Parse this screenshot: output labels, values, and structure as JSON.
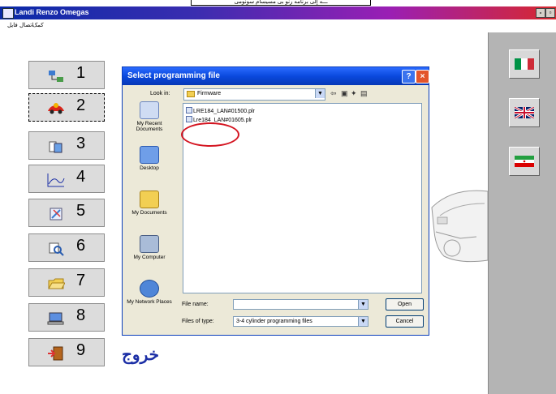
{
  "banner": {
    "text": "ـــه إلى برنامه رنو بی مسیسام سونومی"
  },
  "window": {
    "title": "Landi Renzo Omegas",
    "minimize_label": "-",
    "restore_label": "▫"
  },
  "menu": {
    "items": [
      "فایل",
      "اتصال",
      "کمک"
    ]
  },
  "languages": [
    {
      "name": "italian",
      "colors": [
        "#009246",
        "#ffffff",
        "#ce2b37"
      ]
    },
    {
      "name": "english",
      "colors": [
        "#012169",
        "#ffffff",
        "#c8102e"
      ]
    },
    {
      "name": "persian",
      "colors": [
        "#239f40",
        "#ffffff",
        "#da0000"
      ]
    }
  ],
  "buttons": [
    {
      "num": "1",
      "icon": "tree-network-icon"
    },
    {
      "num": "2",
      "icon": "car-icon"
    },
    {
      "num": "3",
      "icon": "files-icon"
    },
    {
      "num": "4",
      "icon": "graph-line-icon"
    },
    {
      "num": "5",
      "icon": "tools-icon"
    },
    {
      "num": "6",
      "icon": "search-icon"
    },
    {
      "num": "7",
      "icon": "folder-open-icon"
    },
    {
      "num": "8",
      "icon": "computer-icon"
    },
    {
      "num": "9",
      "icon": "exit-door-icon"
    }
  ],
  "exit_label": "خروج",
  "dialog": {
    "title": "Select programming file",
    "help_label": "?",
    "close_label": "×",
    "look_in_label": "Look in:",
    "look_in_value": "Firmware",
    "places": [
      {
        "label": "My Recent Documents"
      },
      {
        "label": "Desktop"
      },
      {
        "label": "My Documents"
      },
      {
        "label": "My Computer"
      },
      {
        "label": "My Network Places"
      }
    ],
    "files": [
      "LRE184_LAN#01500.plr",
      "Lre184_LAN#01605.plr"
    ],
    "file_name_label": "File name:",
    "file_name_value": "",
    "file_type_label": "Files of type:",
    "file_type_value": "3-4 cylinder programming files",
    "open_label": "Open",
    "cancel_label": "Cancel"
  }
}
